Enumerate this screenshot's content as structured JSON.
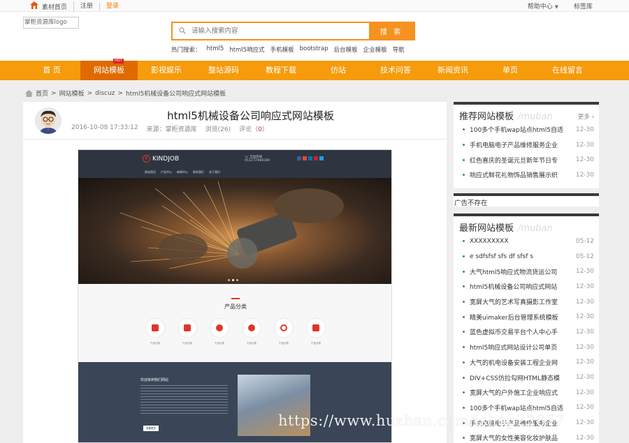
{
  "topbar": {
    "left": [
      "素材",
      "首页",
      "注册",
      "登录"
    ],
    "right": [
      "帮助中心",
      "标签库"
    ]
  },
  "header": {
    "logo_alt": "掌柜资源库logo",
    "search_placeholder": "请输入搜索内容",
    "search_button": "搜 索",
    "hot_label": "热门搜索：",
    "hot_terms": [
      "html5",
      "html5响应式",
      "手机模板",
      "bootstrap",
      "后台模板",
      "企业模板",
      "导航"
    ]
  },
  "nav": {
    "items": [
      "首 页",
      "网站模板",
      "影视娱乐",
      "整站源码",
      "教程下载",
      "仿站",
      "技术问答",
      "新闻资讯",
      "单页",
      "在线留言"
    ],
    "active_index": 1,
    "hot_badge": "HOT"
  },
  "breadcrumb": [
    "首页",
    "网站模板",
    "discuz",
    "html5机械设备公司响应式网站模板"
  ],
  "article": {
    "title": "html5机械设备公司响应式网站模板",
    "date": "2016-10-08 17:33:12",
    "source": "来源：掌柜资源库",
    "views": "浏览(26)",
    "comments_prefix": "评论（",
    "comments_count": "0",
    "comments_suffix": "）"
  },
  "preview": {
    "brand": "KINDJOB",
    "phone_label": "全国热线",
    "phone": "0512-57980289",
    "menu": [
      "网站首页",
      "产品中心",
      "新闻中心",
      "联系我们",
      "关于我们"
    ],
    "category_title": "产品分类",
    "categories": [
      "产品分类",
      "产品分类",
      "产品分类",
      "产品分类",
      "产品分类",
      "产品分类"
    ],
    "about_title": "欢迎来到我们网站",
    "more_button": "查看更多"
  },
  "sidebar": {
    "recommend": {
      "title": "推荐网站模板",
      "subtitle": "/muban",
      "more": "更多",
      "items": [
        {
          "name": "100多个手机wap站点html5自适",
          "date": "12-30"
        },
        {
          "name": "手机电脑电子产品维修服务企业",
          "date": "12-30"
        },
        {
          "name": "红色喜庆的圣诞元旦新年节日专",
          "date": "12-30"
        },
        {
          "name": "响应式鲜花礼物饰品销售展示织",
          "date": "12-30"
        }
      ]
    },
    "ad_text": "广告不存在",
    "latest": {
      "title": "最新网站模板",
      "subtitle": "/muban",
      "items": [
        {
          "name": "XXXXXXXXX",
          "date": "05-12"
        },
        {
          "name": "e sdfsfsf sfs df sfsf s",
          "date": "05-12"
        },
        {
          "name": "大气html5响应式物流货运公司",
          "date": "12-30"
        },
        {
          "name": "html5机械设备公司响应式网站",
          "date": "12-30"
        },
        {
          "name": "宽屏大气的艺术写真摄影工作室",
          "date": "12-30"
        },
        {
          "name": "精美uimaker后台管理系统模板",
          "date": "12-30"
        },
        {
          "name": "蓝色虚拟币交易平台个人中心手",
          "date": "12-30"
        },
        {
          "name": "html5响应式网站设计公司单页",
          "date": "12-30"
        },
        {
          "name": "大气的机电设备安装工程企业网",
          "date": "12-30"
        },
        {
          "name": "DIV+CSS仿拉勾网HTML静态模",
          "date": "12-30"
        },
        {
          "name": "宽屏大气的户外施工企业响应式",
          "date": "12-30"
        },
        {
          "name": "100多个手机wap站点html5自适",
          "date": "12-30"
        },
        {
          "name": "手机电脑电子产品维修服务企业",
          "date": "12-30"
        },
        {
          "name": "宽屏大气的女性美容化妆护肤品",
          "date": "12-30"
        }
      ]
    }
  },
  "watermark": "https://www.huzhan.com/ishop22877"
}
